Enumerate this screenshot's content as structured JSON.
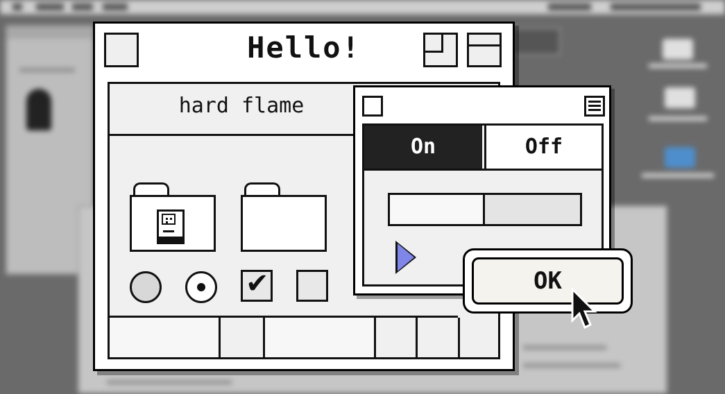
{
  "main_window": {
    "title": "Hello!",
    "tab_label": "hard flame",
    "radios": [
      {
        "name": "radio-unselected",
        "selected": false
      },
      {
        "name": "radio-selected",
        "selected": true
      }
    ],
    "checkboxes": [
      {
        "name": "checkbox-checked",
        "checked": true,
        "mark": "✔"
      },
      {
        "name": "checkbox-unchecked",
        "checked": false
      }
    ]
  },
  "dialog": {
    "toggle": {
      "on_label": "On",
      "off_label": "Off",
      "active": "On"
    },
    "progress_fraction": 0.5
  },
  "ok_button": {
    "label": "OK"
  },
  "icons": {
    "folder": "folder-icon",
    "mac": "macintosh-computer-icon",
    "disclosure": "disclosure-triangle-icon",
    "cursor": "arrow-cursor-icon"
  },
  "colors": {
    "accent_triangle": "#7f86e8",
    "window_bg": "#ffffff",
    "panel_bg": "#f0f0f0",
    "selected_segment": "#222222"
  }
}
